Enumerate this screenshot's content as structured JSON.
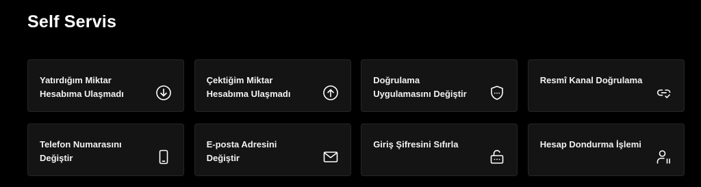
{
  "page": {
    "title": "Self Servis"
  },
  "cards": [
    {
      "label": "Yatırdığım Miktar Hesabıma Ulaşmadı",
      "icon": "arrow-down-circle-icon"
    },
    {
      "label": "Çektiğim Miktar Hesabıma Ulaşmadı",
      "icon": "arrow-up-circle-icon"
    },
    {
      "label": "Doğrulama Uygulamasını Değiştir",
      "icon": "shield-password-icon"
    },
    {
      "label": "Resmî Kanal Doğrulama",
      "icon": "link-check-icon"
    },
    {
      "label": "Telefon Numarasını Değiştir",
      "icon": "smartphone-icon"
    },
    {
      "label": "E-posta Adresini Değiştir",
      "icon": "envelope-icon"
    },
    {
      "label": "Giriş Şifresini Sıfırla",
      "icon": "unlock-password-icon"
    },
    {
      "label": "Hesap Dondurma İşlemi",
      "icon": "user-pause-icon"
    }
  ],
  "colors": {
    "background": "#000000",
    "card_background": "#141414",
    "card_border": "#262626",
    "text": "#ffffff"
  }
}
